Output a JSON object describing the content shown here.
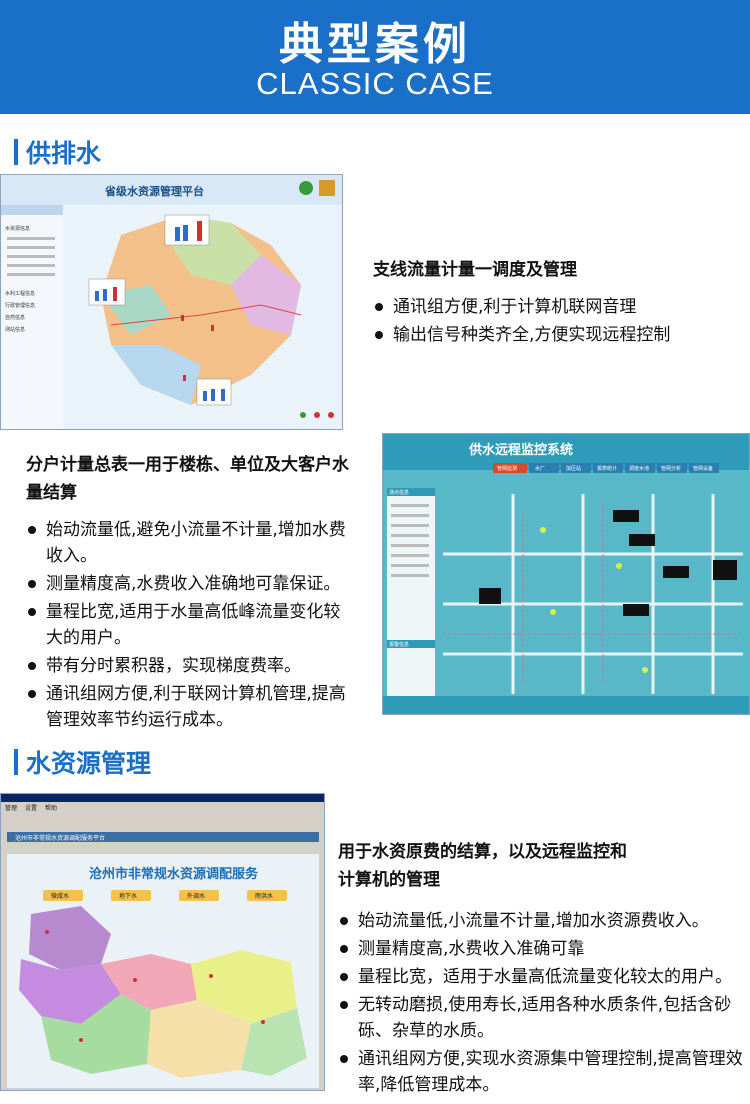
{
  "header": {
    "title": "典型案例",
    "subtitle": "CLASSIC CASE"
  },
  "sections": {
    "supply": {
      "label": "供排水"
    },
    "water": {
      "label": "水资源管理"
    }
  },
  "block1": {
    "heading": "支线流量计量一调度及管理",
    "bullets": [
      "通讯组方便,利于计算机联网音理",
      "输出信号种类齐全,方便实现远程控制"
    ]
  },
  "block2": {
    "heading": "分户计量总表一用于楼栋、单位及大客户水量结算",
    "bullets": [
      "始动流量低,避免小流量不计量,增加水费收入。",
      "测量精度高,水费收入准确地可靠保证。",
      "量程比宽,适用于水量高低峰流量变化较大的用户。",
      "带有分时累积器，实现梯度费率。",
      "通讯组网方便,利于联网计算机管理,提高管理效率节约运行成本。"
    ]
  },
  "block3": {
    "heading": "用于水资原费的结算，以及远程监控和计算机的管理",
    "bullets": [
      "始动流量低,小流量不计量,增加水资源费收入。",
      "测量精度高,水费收入准确可靠",
      "量程比宽，适用于水量高低流量变化较太的用户。",
      "无转动磨损,使用寿长,适用各种水质条件,包括含砂砾、杂草的水质。",
      "通讯组网方便,实现水资源集中管理控制,提高管理效率,降低管理成本。"
    ]
  },
  "screens": {
    "s1": {
      "title": "省级水资源管理平台",
      "sidebar_items": [
        "水资源信息",
        "水利工程信息",
        "行政管理信息",
        "自然信息",
        "测站信息"
      ]
    },
    "s2": {
      "title": "供水远程监控系统",
      "tabs": [
        "管网监测",
        "水厂",
        "加压站",
        "报表统计",
        "调度水池",
        "管网分析",
        "管网设备"
      ],
      "sidebar_title": "测点信息",
      "alarm_title": "报警信息"
    },
    "s3": {
      "title": "沧州市非常规水资源调配服务",
      "window_title": "沧州市非常规水资源调配服务平台",
      "menu": [
        "管理",
        "设置",
        "帮助"
      ],
      "buttons": [
        "微咸水",
        "地下水",
        "外调水",
        "雨洪水"
      ]
    }
  },
  "colors": {
    "brand_blue": "#1a70c8"
  }
}
